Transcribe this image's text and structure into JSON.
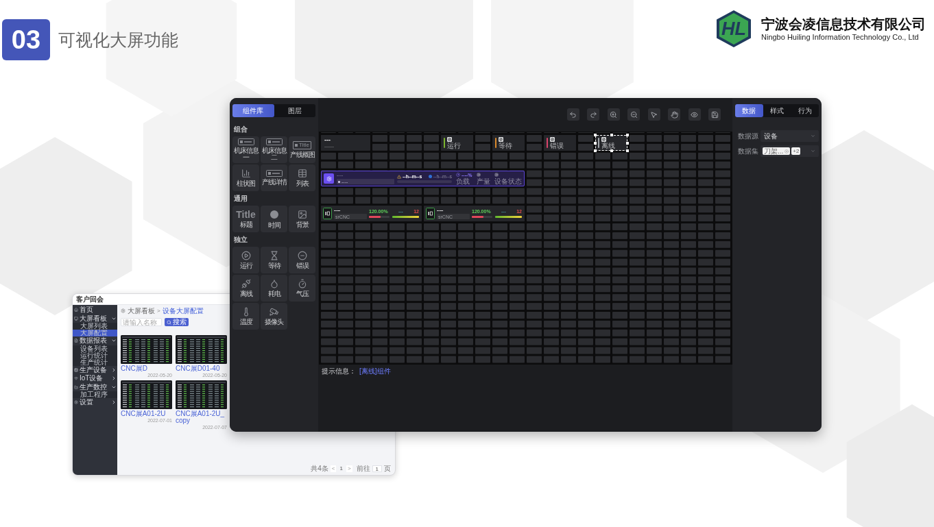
{
  "slide": {
    "number": "03",
    "title": "可视化大屏功能"
  },
  "company": {
    "logo_mark": "HL",
    "name": "宁波会凌信息技术有限公司",
    "name_en": "Ningbo Huiling Information Technology Co., Ltd"
  },
  "admin_window": {
    "title": "客户回会",
    "sidebar": [
      {
        "label": "首页",
        "selected": false
      },
      {
        "label": "大屏看板",
        "selected": false,
        "expanded": true,
        "children": [
          {
            "label": "大屏列表",
            "selected": false
          },
          {
            "label": "大屏配置",
            "selected": true
          }
        ]
      },
      {
        "label": "数据报表",
        "selected": false,
        "expanded": true,
        "children": [
          {
            "label": "设备列表",
            "selected": false
          },
          {
            "label": "运行统计",
            "selected": false
          },
          {
            "label": "生产统计",
            "selected": false
          }
        ]
      },
      {
        "label": "生产设备",
        "selected": false,
        "expanded": false
      },
      {
        "label": "IoT设备",
        "selected": false,
        "expanded": false
      },
      {
        "label": "生产数控",
        "selected": false,
        "expanded": true,
        "children": [
          {
            "label": "加工程序",
            "selected": false
          }
        ]
      },
      {
        "label": "设置",
        "selected": false,
        "expanded": false
      }
    ],
    "breadcrumb": {
      "items": [
        "大屏看板",
        "设备大屏配置"
      ],
      "separator": ">"
    },
    "search": {
      "placeholder": "请输入名称",
      "button": "搜索"
    },
    "cards": [
      {
        "name": "CNC展D",
        "date": "2022-05-20"
      },
      {
        "name": "CNC展D01-40",
        "date": "2022-05-20"
      },
      {
        "name": "CNC展A01-2U",
        "date": "2022-07-01"
      },
      {
        "name": "CNC展A01-2U_copy",
        "date": "2022-07-07"
      }
    ],
    "pagination": {
      "total": "共4条",
      "prev": "<",
      "page": "1",
      "next": ">",
      "goto": "前往",
      "goto_page": "1",
      "suffix": "页"
    }
  },
  "editor": {
    "left_tabs": [
      {
        "label": "组件库",
        "selected": true
      },
      {
        "label": "图层",
        "selected": false
      }
    ],
    "groups": [
      {
        "title": "组合",
        "items": [
          {
            "label": "机床信息一"
          },
          {
            "label": "机床信息二"
          },
          {
            "label": "产线概图",
            "icon_text": "Title"
          },
          {
            "label": "柱状图"
          },
          {
            "label": "产线详情"
          },
          {
            "label": "列表"
          }
        ]
      },
      {
        "title": "通用",
        "items": [
          {
            "label": "标题",
            "icon_text": "Title"
          },
          {
            "label": "时间"
          },
          {
            "label": "背景"
          }
        ]
      },
      {
        "title": "独立",
        "items": [
          {
            "label": "运行"
          },
          {
            "label": "等待"
          },
          {
            "label": "错误"
          },
          {
            "label": "离线"
          },
          {
            "label": "耗电"
          },
          {
            "label": "气压"
          },
          {
            "label": "温度"
          },
          {
            "label": "摄像头"
          }
        ]
      }
    ],
    "right_tabs": [
      {
        "label": "数据",
        "selected": true
      },
      {
        "label": "样式",
        "selected": false
      },
      {
        "label": "行为",
        "selected": false
      }
    ],
    "fields": [
      {
        "kind": "select",
        "label": "数据源",
        "value": "设备"
      },
      {
        "kind": "tags",
        "label": "数据集",
        "tags": [
          "刀架..."
        ],
        "more": "+2"
      }
    ],
    "canvas": {
      "widgets": [
        {
          "kind": "title",
          "selected": false,
          "value": "---",
          "caption": "——"
        },
        {
          "kind": "status",
          "selected": false,
          "label": "运行",
          "color": "#7bb32e"
        },
        {
          "kind": "status",
          "selected": false,
          "label": "等待",
          "color": "#d9882b"
        },
        {
          "kind": "status",
          "selected": false,
          "label": "错误",
          "color": "#d9436a"
        },
        {
          "kind": "status",
          "selected": true,
          "label": "离线",
          "color": "#a3a7ad"
        },
        {
          "kind": "overview",
          "selected": false,
          "title": "----",
          "field": "----",
          "run_time": "--h--m--s",
          "wait_time": "--h--m--s",
          "metrics": [
            {
              "value": "----%",
              "label": "负载"
            },
            {
              "label": "产量"
            },
            {
              "label": "设备状态"
            }
          ]
        },
        {
          "kind": "machine",
          "selected": false,
          "name": "----",
          "program": "srCNC",
          "rate": "120.00%",
          "value": "---",
          "count": "12",
          "level": 0.55
        },
        {
          "kind": "machine",
          "selected": false,
          "name": "----",
          "program": "srCNC",
          "rate": "120.00%",
          "value": "---",
          "count": "12",
          "level": 0.55
        }
      ]
    },
    "hint": {
      "label": "提示信息：",
      "value": "[离线]组件"
    }
  }
}
